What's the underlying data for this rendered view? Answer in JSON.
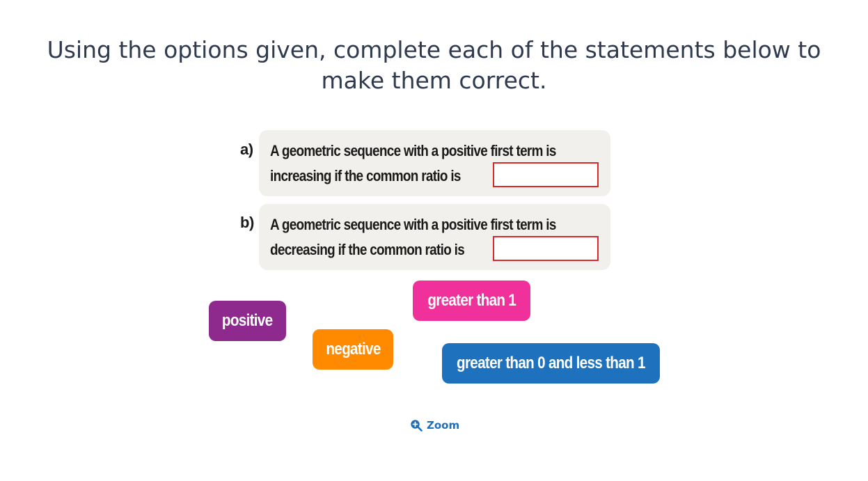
{
  "question": {
    "title": "Using the options given, complete each of the statements below to make them correct."
  },
  "statements": [
    {
      "label": "a)",
      "line1": "A geometric sequence with a positive first term is",
      "line2": "increasing if the common ratio is"
    },
    {
      "label": "b)",
      "line1": "A geometric sequence with a positive first term is",
      "line2": "decreasing if the common ratio is"
    }
  ],
  "options": [
    {
      "label": "positive",
      "color": "#8e2a8e"
    },
    {
      "label": "negative",
      "color": "#ff8a00"
    },
    {
      "label": "greater than 1",
      "color": "#f0319c"
    },
    {
      "label": "greater than 0 and less than 1",
      "color": "#1e72bd"
    }
  ],
  "zoom": {
    "label": "Zoom",
    "icon": "zoom-in-icon"
  },
  "colors": {
    "title_text": "#2f3a4f",
    "statement_bg": "#f2f0ec",
    "drop_zone_border": "#d92a2a",
    "zoom_blue": "#1f6fb8"
  }
}
